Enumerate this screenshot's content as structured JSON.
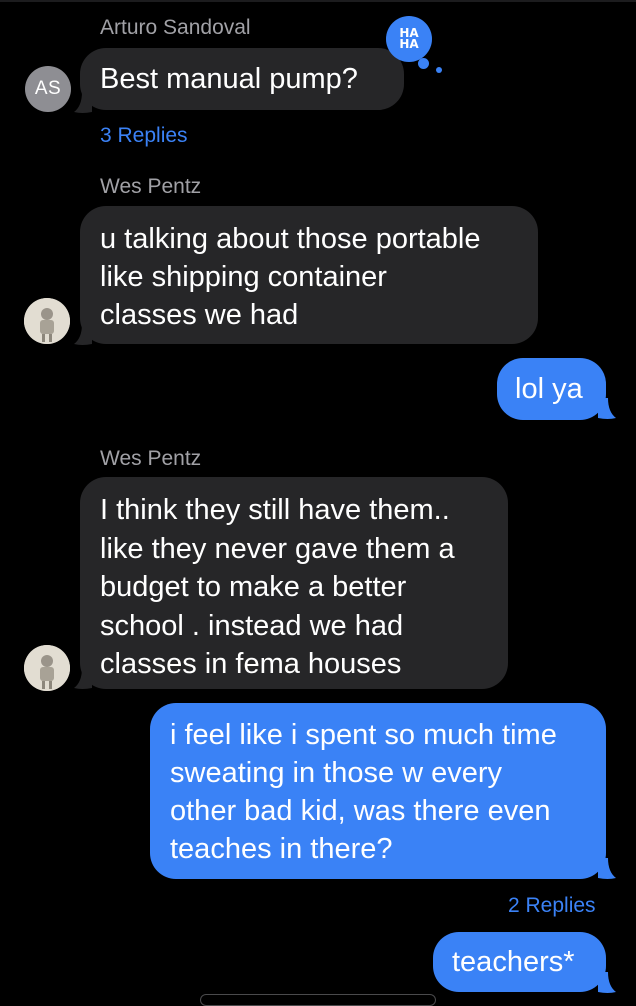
{
  "messages": [
    {
      "sender": "Arturo Sandoval",
      "initials": "AS",
      "text": "Best manual pump?",
      "reaction": {
        "line1": "HA",
        "line2": "HA"
      },
      "replies": "3 Replies"
    },
    {
      "sender": "Wes Pentz",
      "text": "u talking about those portable\nlike shipping container\nclasses we had"
    },
    {
      "outgoing": true,
      "text": "lol ya"
    },
    {
      "sender": "Wes Pentz",
      "text": "I think they still have them..\nlike they never gave them a\nbudget to make a better\nschool . instead we had\nclasses in fema houses"
    },
    {
      "outgoing": true,
      "text": "i feel like i spent so much time\nsweating in those w every\nother bad kid, was there even\nteaches in there?",
      "replies": "2 Replies"
    },
    {
      "outgoing": true,
      "text": "teachers*"
    }
  ],
  "colors": {
    "background": "#000000",
    "incoming_bubble": "#262628",
    "outgoing_bubble": "#3a82f6",
    "link": "#3b82f6",
    "sender_name": "#a1a1a6"
  }
}
